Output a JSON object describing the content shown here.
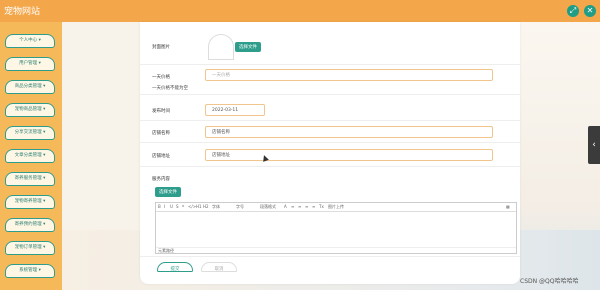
{
  "app": {
    "title": "宠物网站"
  },
  "topbar": {
    "icon_left": "⤢",
    "icon_right": "✕"
  },
  "sidebar": {
    "items": [
      {
        "label": "个人中心 ▾"
      },
      {
        "label": "用户管理 ▾"
      },
      {
        "label": "商品分类管理 ▾"
      },
      {
        "label": "宠物商品管理 ▾"
      },
      {
        "label": "分享交流管理 ▾"
      },
      {
        "label": "文章分类管理 ▾"
      },
      {
        "label": "寄养服务管理 ▾"
      },
      {
        "label": "宠物寄养管理 ▾"
      },
      {
        "label": "寄养预约管理 ▾"
      },
      {
        "label": "宠物订单管理 ▾"
      },
      {
        "label": "系统管理 ▾"
      }
    ]
  },
  "form": {
    "cover_image_label": "封面图片",
    "upload_button": "选择文件",
    "one_day_price_label": "一天价格",
    "one_day_price_placeholder": "一天价格",
    "price_required_note": "一天价格不能为空",
    "publish_time_label": "发布时间",
    "publish_time_value": "2022-03-11",
    "store_name_label": "店铺名称",
    "store_name_value": "店铺名称",
    "store_address_label": "店铺地址",
    "store_address_value": "店铺地址",
    "service_content_label": "服务内容",
    "service_upload_button": "选择文件",
    "editor": {
      "toolbar": [
        "B",
        "I",
        "U",
        "S",
        "❝",
        "</>",
        "H1",
        "H2",
        "字体",
        "字号",
        "段落格式",
        "A",
        "≡",
        "≡",
        "≡",
        "≡",
        "Tx",
        "图片上传",
        "▦"
      ],
      "footer": "元素路径"
    },
    "submit_button": "提交",
    "cancel_button": "取消"
  },
  "watermark": "CSDN @QQ哈哈哈哈"
}
